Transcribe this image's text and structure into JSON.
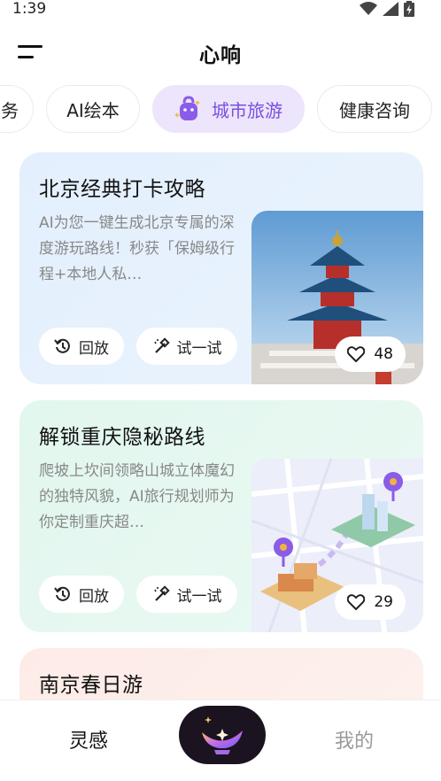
{
  "status": {
    "time": "1:39"
  },
  "header": {
    "title": "心响"
  },
  "tabs": [
    {
      "label": "务"
    },
    {
      "label": "AI绘本"
    },
    {
      "label": "城市旅游",
      "active": true
    },
    {
      "label": "健康咨询"
    }
  ],
  "cards": [
    {
      "title": "北京经典打卡攻略",
      "description": "AI为您一键生成北京专属的深度游玩路线！秒获「保姆级行程+本地人私…",
      "replay_label": "回放",
      "try_label": "试一试",
      "likes": "48",
      "image": "temple-of-heaven-photo",
      "bg_color": "#e7f2fd"
    },
    {
      "title": "解锁重庆隐秘路线",
      "description": "爬坡上坎间领略山城立体魔幻的独特风貌，AI旅行规划师为你定制重庆超…",
      "replay_label": "回放",
      "try_label": "试一试",
      "likes": "29",
      "image": "isometric-city-map",
      "bg_color": "#e6f8f0"
    },
    {
      "title": "南京春日游",
      "bg_color": "#fdeeea"
    }
  ],
  "bottom_nav": {
    "left_label": "灵感",
    "right_label": "我的",
    "center_icon": "magic-lamp-icon"
  },
  "colors": {
    "accent": "#7a4ee0",
    "active_tab_bg": "#ece5fb"
  }
}
